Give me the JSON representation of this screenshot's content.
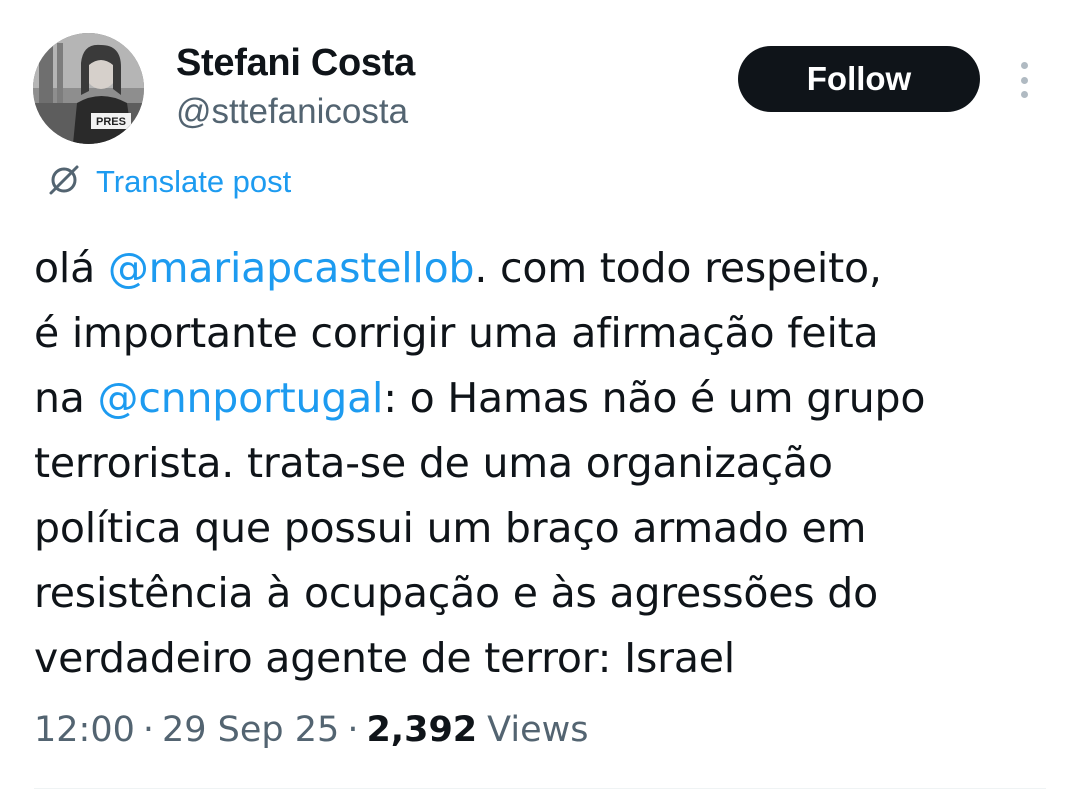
{
  "author": {
    "display_name": "Stefani Costa",
    "handle": "@sttefanicosta",
    "avatar_badge_text": "PRES"
  },
  "actions": {
    "follow_label": "Follow",
    "more_icon": "more-vertical-icon"
  },
  "translate": {
    "icon": "globe-slash-icon",
    "label": "Translate post"
  },
  "tweet": {
    "lines": [
      [
        {
          "text": "olá "
        },
        {
          "text": "@mariapcastellob",
          "mention": true
        },
        {
          "text": ". com todo respeito,"
        }
      ],
      [
        {
          "text": "é importante corrigir uma afirmação feita"
        }
      ],
      [
        {
          "text": "na "
        },
        {
          "text": "@cnnportugal",
          "mention": true
        },
        {
          "text": ": o Hamas não é um grupo"
        }
      ],
      [
        {
          "text": "terrorista. trata-se de uma organização"
        }
      ],
      [
        {
          "text": "política que possui um braço armado em"
        }
      ],
      [
        {
          "text": "resistência à ocupação e às agressões do"
        }
      ],
      [
        {
          "text": "verdadeiro agente de terror: Israel"
        }
      ]
    ]
  },
  "meta": {
    "time": "12:00",
    "separator": "·",
    "date": "29 Sep 25",
    "views_count": "2,392",
    "views_label": "Views"
  },
  "colors": {
    "link": "#1d9bf0",
    "text_primary": "#0f1419",
    "text_secondary": "#536471",
    "button_bg": "#0f1419"
  }
}
